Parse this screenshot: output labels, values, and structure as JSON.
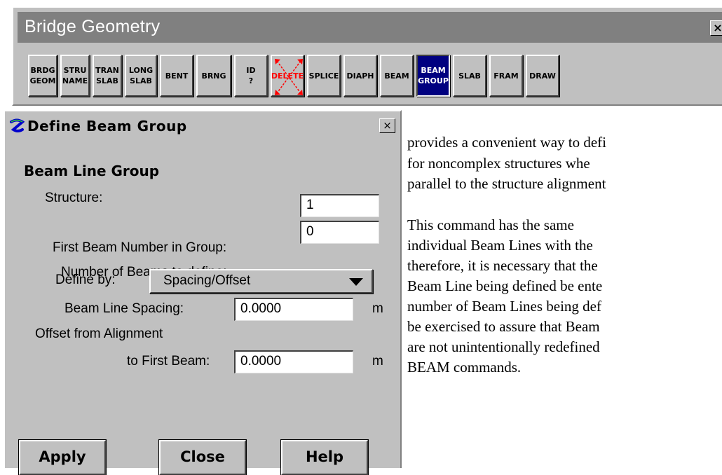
{
  "bridge_geometry": {
    "title": "Bridge Geometry",
    "close_glyph": "×",
    "buttons": [
      {
        "id": "brdg_geom",
        "label": "BRDG\nGEOM"
      },
      {
        "id": "stru_name",
        "label": "STRU\nNAME"
      },
      {
        "id": "tran_slab",
        "label": "TRAN\nSLAB"
      },
      {
        "id": "long_slab",
        "label": "LONG\nSLAB"
      },
      {
        "id": "bent",
        "label": "BENT"
      },
      {
        "id": "brng",
        "label": "BRNG"
      },
      {
        "id": "id",
        "label": "ID\n?"
      },
      {
        "id": "delete",
        "label": "DELETE"
      },
      {
        "id": "splice",
        "label": "SPLICE"
      },
      {
        "id": "diaph",
        "label": "DIAPH"
      },
      {
        "id": "beam",
        "label": "BEAM"
      },
      {
        "id": "beam_group",
        "label": "BEAM\nGROUP",
        "selected": true
      },
      {
        "id": "slab",
        "label": "SLAB"
      },
      {
        "id": "fram",
        "label": "FRAM"
      },
      {
        "id": "draw",
        "label": "DRAW"
      }
    ]
  },
  "dialog": {
    "title": "Define Beam Group",
    "close_glyph": "×",
    "section_title": "Beam Line Group",
    "structure_label": "Structure:",
    "first_beam_label": "First Beam Number in Group:",
    "first_beam_value": "1",
    "num_beams_label": "Number of Beams to define:",
    "num_beams_value": "0",
    "define_by_label": "Define by:",
    "define_by_value": "Spacing/Offset",
    "spacing_label": "Beam Line Spacing:",
    "spacing_value": "0.0000",
    "spacing_unit": "m",
    "offset_label_1": "Offset from Alignment",
    "offset_label_2": "to First Beam:",
    "offset_value": "0.0000",
    "offset_unit": "m",
    "apply_label": "Apply",
    "close_label": "Close",
    "help_label": "Help"
  },
  "document": {
    "lines": [
      "provides a convenient way to defi",
      "for noncomplex structures whe",
      "parallel to the structure alignment",
      "This command has the same",
      "individual Beam Lines with the",
      "therefore, it is necessary that the",
      "Beam Line being defined be ente",
      "number of Beam Lines being def",
      "be exercised to assure that Beam",
      "are not unintentionally redefined",
      "BEAM commands."
    ]
  },
  "colors": {
    "face": "#c0c0c0",
    "title_bar": "#808080",
    "selected_button": "#000080",
    "delete_red": "#ff0000"
  },
  "icons": {
    "dialog_app_icon": "app-logo-icon",
    "dropdown_arrow": "triangle-down-icon"
  }
}
